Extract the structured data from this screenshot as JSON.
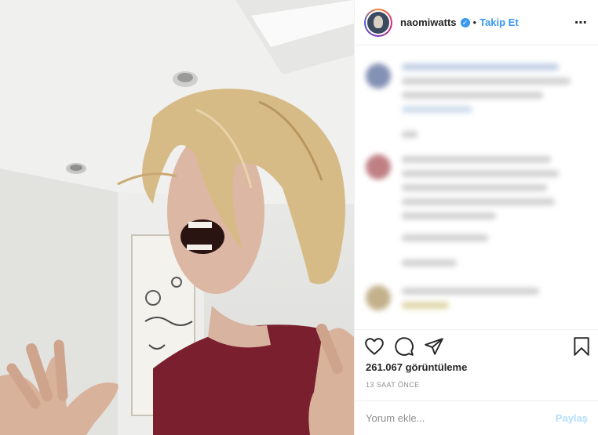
{
  "post": {
    "username": "naomiwatts",
    "verified_mark": "✓",
    "separator": "•",
    "follow_label": "Takip Et",
    "more_icon": "⋯",
    "views": "261.067 görüntüleme",
    "time_ago": "13 SAAT ÖNCE"
  },
  "comment_form": {
    "placeholder": "Yorum ekle...",
    "post_label": "Paylaş"
  },
  "icons": {
    "like": "heart-icon",
    "comment": "comment-icon",
    "share": "share-icon",
    "save": "bookmark-icon"
  },
  "colors": {
    "accent": "#3897f0",
    "post_disabled": "#b2dffc",
    "meta_gray": "#8e8e8e",
    "shirt": "#7a1f2e"
  }
}
